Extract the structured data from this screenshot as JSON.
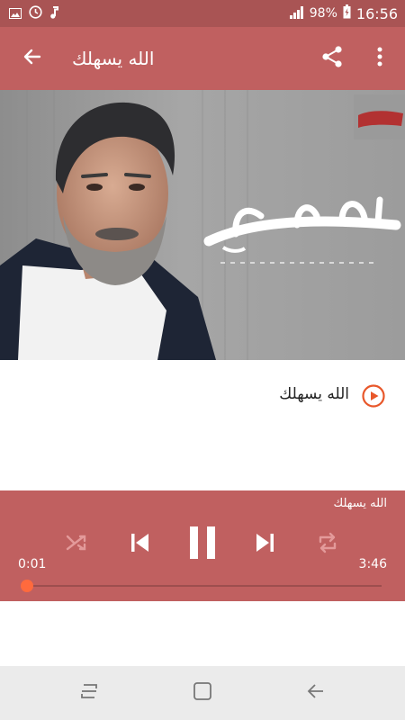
{
  "status_bar": {
    "battery": "98%",
    "time": "16:56",
    "icons": [
      "image-icon",
      "timer-icon",
      "music-note-icon",
      "signal-icon",
      "battery-icon"
    ]
  },
  "app_bar": {
    "title": "الله يسهلك",
    "back_icon": "arrow-left-icon",
    "share_icon": "share-icon",
    "more_icon": "more-vertical-icon"
  },
  "tracks": [
    {
      "title": "الله يسهلك",
      "icon": "play-circle-icon"
    }
  ],
  "player": {
    "now_playing": "الله يسهلك",
    "elapsed": "0:01",
    "duration": "3:46",
    "progress": 0.004,
    "controls": [
      "shuffle-icon",
      "skip-previous-icon",
      "pause-icon",
      "skip-next-icon",
      "repeat-icon"
    ]
  },
  "nav_bar": {
    "buttons": [
      "recents-icon",
      "home-icon",
      "back-icon"
    ]
  },
  "colors": {
    "status_bar": "#a95454",
    "app_bar": "#c06060",
    "accent": "#ff6a3d",
    "track_icon": "#e8572a"
  }
}
